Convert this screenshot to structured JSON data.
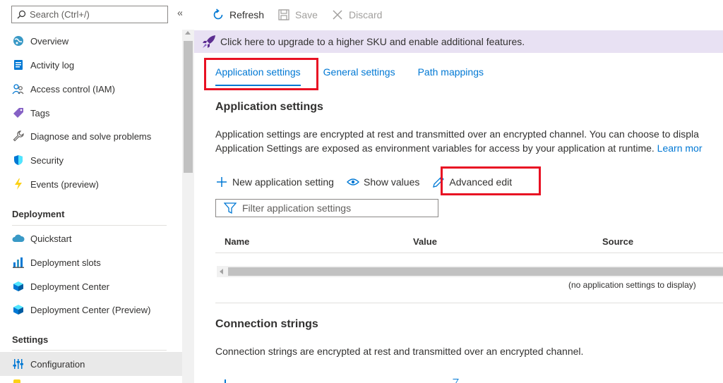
{
  "sidebar": {
    "search_placeholder": "Search (Ctrl+/)",
    "collapse": "«",
    "items": [
      {
        "label": "Overview"
      },
      {
        "label": "Activity log"
      },
      {
        "label": "Access control (IAM)"
      },
      {
        "label": "Tags"
      },
      {
        "label": "Diagnose and solve problems"
      },
      {
        "label": "Security"
      },
      {
        "label": "Events (preview)"
      }
    ],
    "deployment_header": "Deployment",
    "deployment_items": [
      {
        "label": "Quickstart"
      },
      {
        "label": "Deployment slots"
      },
      {
        "label": "Deployment Center"
      },
      {
        "label": "Deployment Center (Preview)"
      }
    ],
    "settings_header": "Settings",
    "settings_items": [
      {
        "label": "Configuration",
        "active": true
      }
    ]
  },
  "toolbar": {
    "refresh_label": "Refresh",
    "save_label": "Save",
    "discard_label": "Discard"
  },
  "banner": {
    "text": "Click here to upgrade to a higher SKU and enable additional features."
  },
  "tabs": [
    {
      "label": "Application settings",
      "active": true
    },
    {
      "label": "General settings"
    },
    {
      "label": "Path mappings"
    }
  ],
  "app_settings": {
    "title": "Application settings",
    "desc_line1": "Application settings are encrypted at rest and transmitted over an encrypted channel. You can choose to displa",
    "desc_line2": "Application Settings are exposed as environment variables for access by your application at runtime.",
    "learn_more": "Learn mor",
    "new_label": "New application setting",
    "show_values_label": "Show values",
    "advanced_edit_label": "Advanced edit",
    "filter_placeholder": "Filter application settings",
    "columns": [
      "Name",
      "Value",
      "Source"
    ],
    "empty_text": "(no application settings to display)"
  },
  "connection_strings": {
    "title": "Connection strings",
    "desc": "Connection strings are encrypted at rest and transmitted over an encrypted channel."
  },
  "colors": {
    "accent": "#0078d4",
    "highlight": "#e81123",
    "banner_bg": "#e8e1f3",
    "active_item_bg": "#e9e9e9"
  }
}
